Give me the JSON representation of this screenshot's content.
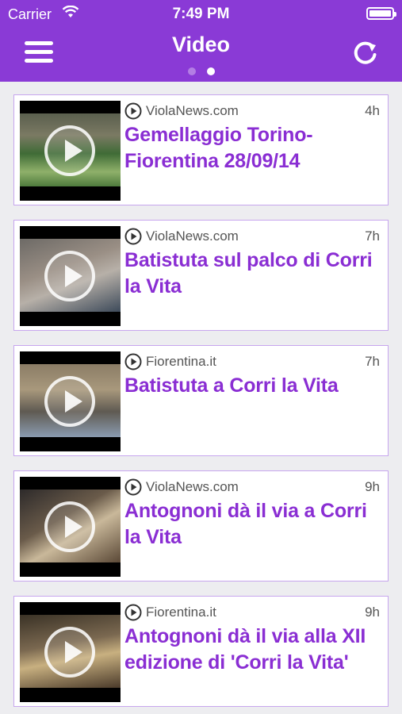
{
  "status_bar": {
    "carrier": "Carrier",
    "time": "7:49 PM"
  },
  "header": {
    "title": "Video",
    "page_dots": 2,
    "active_dot": 1
  },
  "items": [
    {
      "source": "ViolaNews.com",
      "age": "4h",
      "title": "Gemellaggio Torino-Fiorentina 28/09/14"
    },
    {
      "source": "ViolaNews.com",
      "age": "7h",
      "title": "Batistuta sul palco di Corri la Vita"
    },
    {
      "source": "Fiorentina.it",
      "age": "7h",
      "title": "Batistuta a Corri la Vita"
    },
    {
      "source": "ViolaNews.com",
      "age": "9h",
      "title": "Antognoni dà il via a Corri la Vita"
    },
    {
      "source": "Fiorentina.it",
      "age": "9h",
      "title": "Antognoni dà il via alla XII edizione di 'Corri la Vita'"
    }
  ],
  "colors": {
    "accent": "#8a3ad6",
    "headline": "#8a2ed3",
    "card_border": "#c7a6ee"
  },
  "icons": {
    "menu": "hamburger-icon",
    "refresh": "refresh-icon",
    "play": "play-icon",
    "source": "play-circle-icon"
  }
}
